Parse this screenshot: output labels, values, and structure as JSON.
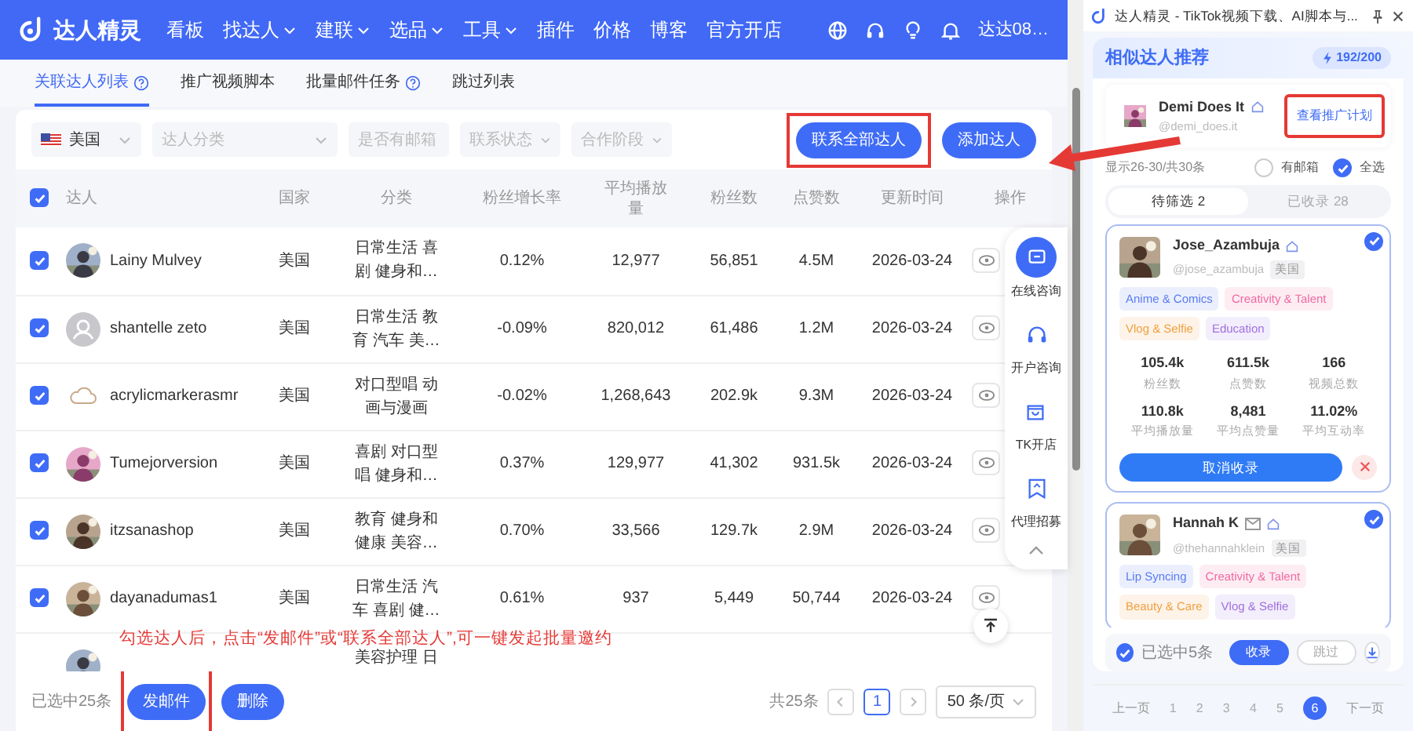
{
  "nav": {
    "brand": "达人精灵",
    "items": [
      {
        "label": "看板",
        "dropdown": false
      },
      {
        "label": "找达人",
        "dropdown": true
      },
      {
        "label": "建联",
        "dropdown": true
      },
      {
        "label": "选品",
        "dropdown": true
      },
      {
        "label": "工具",
        "dropdown": true
      },
      {
        "label": "插件",
        "dropdown": false
      },
      {
        "label": "价格",
        "dropdown": false
      },
      {
        "label": "博客",
        "dropdown": false
      },
      {
        "label": "官方开店",
        "dropdown": false
      }
    ],
    "user": "达达08…"
  },
  "tabs": [
    {
      "label": "关联达人列表",
      "selected": true,
      "help": true
    },
    {
      "label": "推广视频脚本",
      "selected": false,
      "help": false
    },
    {
      "label": "批量邮件任务",
      "selected": false,
      "help": true
    },
    {
      "label": "跳过列表",
      "selected": false,
      "help": false
    }
  ],
  "filters": [
    {
      "kind": "country",
      "value": "美国"
    },
    {
      "kind": "select",
      "placeholder": "达人分类"
    },
    {
      "kind": "select",
      "placeholder": "是否有邮箱"
    },
    {
      "kind": "select",
      "placeholder": "联系状态"
    },
    {
      "kind": "select",
      "placeholder": "合作阶段"
    }
  ],
  "actions": [
    {
      "label": "联系全部达人",
      "highlighted": true
    },
    {
      "label": "添加达人",
      "highlighted": false
    }
  ],
  "table": {
    "all_checked": true,
    "columns": [
      "达人",
      "国家",
      "分类",
      "粉丝增长率",
      "平均播放量",
      "粉丝数",
      "点赞数",
      "更新时间",
      "操作"
    ],
    "rows": [
      {
        "checked": true,
        "name": "Lainy Mulvey",
        "country": "美国",
        "category": "日常生活 喜剧 健身和…",
        "growth": "0.12%",
        "views": "12,977",
        "followers": "56,851",
        "likes": "4.5M",
        "updated": "2026-03-24"
      },
      {
        "checked": true,
        "kind": "placeholder",
        "name": "shantelle zeto",
        "country": "美国",
        "category": "日常生活 教育 汽车 美…",
        "growth": "-0.09%",
        "views": "820,012",
        "followers": "61,486",
        "likes": "1.2M",
        "updated": "2026-03-24"
      },
      {
        "checked": true,
        "kind": "cloud",
        "name": "acrylicmarkerasmr",
        "country": "美国",
        "category": "对口型唱 动画与漫画",
        "growth": "-0.02%",
        "views": "1,268,643",
        "followers": "202.9k",
        "likes": "9.3M",
        "updated": "2026-03-24"
      },
      {
        "checked": true,
        "name": "Tumejorversion",
        "country": "美国",
        "category": "喜剧 对口型唱 健身和…",
        "growth": "0.37%",
        "views": "129,977",
        "followers": "41,302",
        "likes": "931.5k",
        "updated": "2026-03-24"
      },
      {
        "checked": true,
        "name": "itzsanashop",
        "country": "美国",
        "category": "教育 健身和健康 美容…",
        "growth": "0.70%",
        "views": "33,566",
        "followers": "129.7k",
        "likes": "2.9M",
        "updated": "2026-03-24"
      },
      {
        "checked": true,
        "name": "dayanadumas1",
        "country": "美国",
        "category": "日常生活 汽车 喜剧 健…",
        "growth": "0.61%",
        "views": "937",
        "followers": "5,449",
        "likes": "50,744",
        "updated": "2026-03-24"
      },
      {
        "category": "美容护理 日"
      }
    ]
  },
  "annotation": "勾选达人后，点击“发邮件”或“联系全部达人”,可一键发起批量邀约",
  "side_widget": [
    {
      "kind": "chat",
      "label": "在线咨询",
      "primary": true
    },
    {
      "kind": "headset",
      "label": "开户咨询",
      "primary": false
    },
    {
      "kind": "bag",
      "label": "TK开店",
      "primary": false
    },
    {
      "kind": "bookmark",
      "label": "代理招募",
      "primary": false
    }
  ],
  "footer": {
    "selected_text": "已选中25条",
    "buttons": [
      {
        "label": "发邮件",
        "highlighted": true
      },
      {
        "label": "删除",
        "highlighted": false
      }
    ],
    "total": "共25条",
    "pages": [
      {
        "label": "1",
        "selected": true
      }
    ],
    "page_size": "50 条/页"
  },
  "panel": {
    "title": "达人精灵 - TikTok视频下载、AI脚本与...",
    "heading": "相似达人推荐",
    "quota": "192/200",
    "source": {
      "name": "Demi Does It",
      "handle": "@demi_does.it",
      "button": "查看推广计划",
      "highlighted": true
    },
    "range": "显示26-30/共30条",
    "options": [
      {
        "label": "有邮箱",
        "checked": false
      },
      {
        "label": "全选",
        "checked": true
      }
    ],
    "tabs": [
      {
        "label": "待筛选 2",
        "selected": true
      },
      {
        "label": "已收录 28",
        "selected": false
      }
    ],
    "creators": [
      {
        "name": "Jose_Azambuja",
        "mail": false,
        "handle": "@jose_azambuja",
        "country": "美国",
        "checked": true,
        "tags": [
          {
            "label": "Anime & Comics",
            "color": "#5b7cf0"
          },
          {
            "label": "Creativity & Talent",
            "color": "#f06aa0"
          },
          {
            "label": "Vlog & Selfie",
            "color": "#f0a040"
          },
          {
            "label": "Education",
            "color": "#a070e0"
          }
        ],
        "stats": [
          {
            "value": "105.4k",
            "label": "粉丝数"
          },
          {
            "value": "611.5k",
            "label": "点赞数"
          },
          {
            "value": "166",
            "label": "视频总数"
          },
          {
            "value": "110.8k",
            "label": "平均播放量"
          },
          {
            "value": "8,481",
            "label": "平均点赞量"
          },
          {
            "value": "11.02%",
            "label": "平均互动率"
          }
        ],
        "action": "取消收录"
      },
      {
        "name": "Hannah K",
        "mail": true,
        "handle": "@thehannahklein",
        "country": "美国",
        "checked": true,
        "tags": [
          {
            "label": "Lip Syncing",
            "color": "#5b7cf0"
          },
          {
            "label": "Creativity & Talent",
            "color": "#f06aa0"
          },
          {
            "label": "Beauty & Care",
            "color": "#f0a040"
          },
          {
            "label": "Vlog & Selfie",
            "color": "#a070e0"
          }
        ]
      }
    ],
    "bulk": {
      "checked": true,
      "label": "已选中5条",
      "buttons": [
        {
          "label": "收录",
          "kind": "primary"
        },
        {
          "label": "跳过",
          "kind": "outline"
        }
      ]
    },
    "pages": [
      {
        "label": "上一页",
        "kind": "nav",
        "selected": false
      },
      {
        "label": "1",
        "kind": "page",
        "selected": false
      },
      {
        "label": "2",
        "kind": "page",
        "selected": false
      },
      {
        "label": "3",
        "kind": "page",
        "selected": false
      },
      {
        "label": "4",
        "kind": "page",
        "selected": false
      },
      {
        "label": "5",
        "kind": "page",
        "selected": false
      },
      {
        "label": "6",
        "kind": "page",
        "selected": true
      },
      {
        "label": "下一页",
        "kind": "nav",
        "selected": false
      }
    ]
  }
}
